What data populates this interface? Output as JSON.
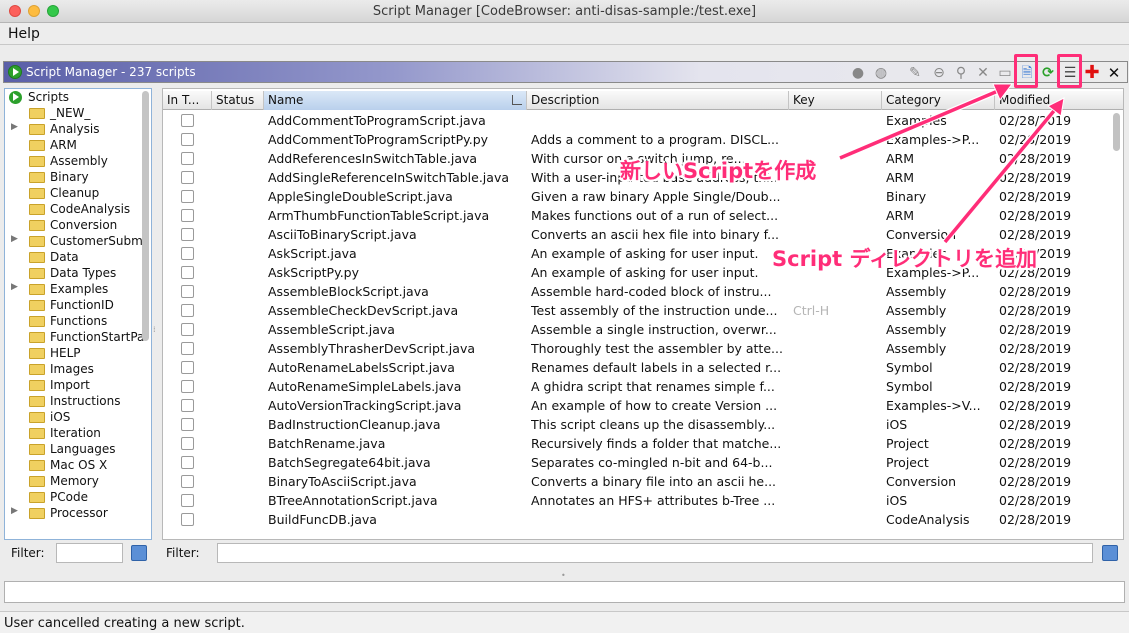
{
  "window": {
    "title": "Script Manager [CodeBrowser: anti-disas-sample:/test.exe]"
  },
  "menu": {
    "help": "Help"
  },
  "panel": {
    "title": "Script Manager - 237 scripts"
  },
  "tree": {
    "root": "Scripts",
    "items": [
      {
        "label": "_NEW_",
        "expandable": false
      },
      {
        "label": "Analysis",
        "expandable": true
      },
      {
        "label": "ARM",
        "expandable": false
      },
      {
        "label": "Assembly",
        "expandable": false
      },
      {
        "label": "Binary",
        "expandable": false
      },
      {
        "label": "Cleanup",
        "expandable": false
      },
      {
        "label": "CodeAnalysis",
        "expandable": false
      },
      {
        "label": "Conversion",
        "expandable": false
      },
      {
        "label": "CustomerSubm",
        "expandable": true
      },
      {
        "label": "Data",
        "expandable": false
      },
      {
        "label": "Data Types",
        "expandable": false
      },
      {
        "label": "Examples",
        "expandable": true
      },
      {
        "label": "FunctionID",
        "expandable": false
      },
      {
        "label": "Functions",
        "expandable": false
      },
      {
        "label": "FunctionStartPa",
        "expandable": false
      },
      {
        "label": "HELP",
        "expandable": false
      },
      {
        "label": "Images",
        "expandable": false
      },
      {
        "label": "Import",
        "expandable": false
      },
      {
        "label": "Instructions",
        "expandable": false
      },
      {
        "label": "iOS",
        "expandable": false
      },
      {
        "label": "Iteration",
        "expandable": false
      },
      {
        "label": "Languages",
        "expandable": false
      },
      {
        "label": "Mac OS X",
        "expandable": false
      },
      {
        "label": "Memory",
        "expandable": false
      },
      {
        "label": "PCode",
        "expandable": false
      },
      {
        "label": "Processor",
        "expandable": true
      }
    ]
  },
  "table": {
    "headers": [
      "In T...",
      "Status",
      "Name",
      "Description",
      "Key",
      "Category",
      "Modified"
    ],
    "rows": [
      [
        "AddCommentToProgramScript.java",
        "",
        "",
        "Examples",
        "02/28/2019"
      ],
      [
        "AddCommentToProgramScriptPy.py",
        "Adds a comment to a program.  DISCL...",
        "",
        "Examples->P...",
        "02/28/2019"
      ],
      [
        "AddReferencesInSwitchTable.java",
        "With cursor on a switch jump, re...",
        "",
        "ARM",
        "02/28/2019"
      ],
      [
        "AddSingleReferenceInSwitchTable.java",
        "With a user-inputted base address, thi...",
        "",
        "ARM",
        "02/28/2019"
      ],
      [
        "AppleSingleDoubleScript.java",
        "Given a raw binary Apple Single/Doub...",
        "",
        "Binary",
        "02/28/2019"
      ],
      [
        "ArmThumbFunctionTableScript.java",
        "Makes functions out of a run of select...",
        "",
        "ARM",
        "02/28/2019"
      ],
      [
        "AsciiToBinaryScript.java",
        "Converts an ascii hex file into binary f...",
        "",
        "Conversion",
        "02/28/2019"
      ],
      [
        "AskScript.java",
        "An example of asking for user input.",
        "",
        "Examples",
        "02/28/2019"
      ],
      [
        "AskScriptPy.py",
        "An example of asking for user input.",
        "",
        "Examples->P...",
        "02/28/2019"
      ],
      [
        "AssembleBlockScript.java",
        "Assemble hard-coded block of instru...",
        "",
        "Assembly",
        "02/28/2019"
      ],
      [
        "AssembleCheckDevScript.java",
        "Test assembly of the instruction unde...",
        "Ctrl-H",
        "Assembly",
        "02/28/2019"
      ],
      [
        "AssembleScript.java",
        "Assemble a single instruction, overwr...",
        "",
        "Assembly",
        "02/28/2019"
      ],
      [
        "AssemblyThrasherDevScript.java",
        "Thoroughly test the assembler by atte...",
        "",
        "Assembly",
        "02/28/2019"
      ],
      [
        "AutoRenameLabelsScript.java",
        "Renames default labels in a selected r...",
        "",
        "Symbol",
        "02/28/2019"
      ],
      [
        "AutoRenameSimpleLabels.java",
        "A ghidra script that renames simple f...",
        "",
        "Symbol",
        "02/28/2019"
      ],
      [
        "AutoVersionTrackingScript.java",
        "An example of how to create Version ...",
        "",
        "Examples->V...",
        "02/28/2019"
      ],
      [
        "BadInstructionCleanup.java",
        "This script cleans up the disassembly...",
        "",
        "iOS",
        "02/28/2019"
      ],
      [
        "BatchRename.java",
        "Recursively finds a folder that matche...",
        "",
        "Project",
        "02/28/2019"
      ],
      [
        "BatchSegregate64bit.java",
        "Separates co-mingled n-bit and 64-b...",
        "",
        "Project",
        "02/28/2019"
      ],
      [
        "BinaryToAsciiScript.java",
        "Converts a binary file into an ascii he...",
        "",
        "Conversion",
        "02/28/2019"
      ],
      [
        "BTreeAnnotationScript.java",
        "Annotates an HFS+ attributes b-Tree ...",
        "",
        "iOS",
        "02/28/2019"
      ],
      [
        "BuildFuncDB.java",
        "",
        "",
        "CodeAnalysis",
        "02/28/2019"
      ]
    ]
  },
  "filters": {
    "left_label": "Filter:",
    "right_label": "Filter:"
  },
  "status": {
    "text": "User cancelled creating a new script."
  },
  "annotations": {
    "new_script": "新しいScriptを作成",
    "add_directory": "Script ディレクトリを追加"
  },
  "colors": {
    "highlight": "#ff2d78",
    "header_blue": "#5a5fa8"
  }
}
